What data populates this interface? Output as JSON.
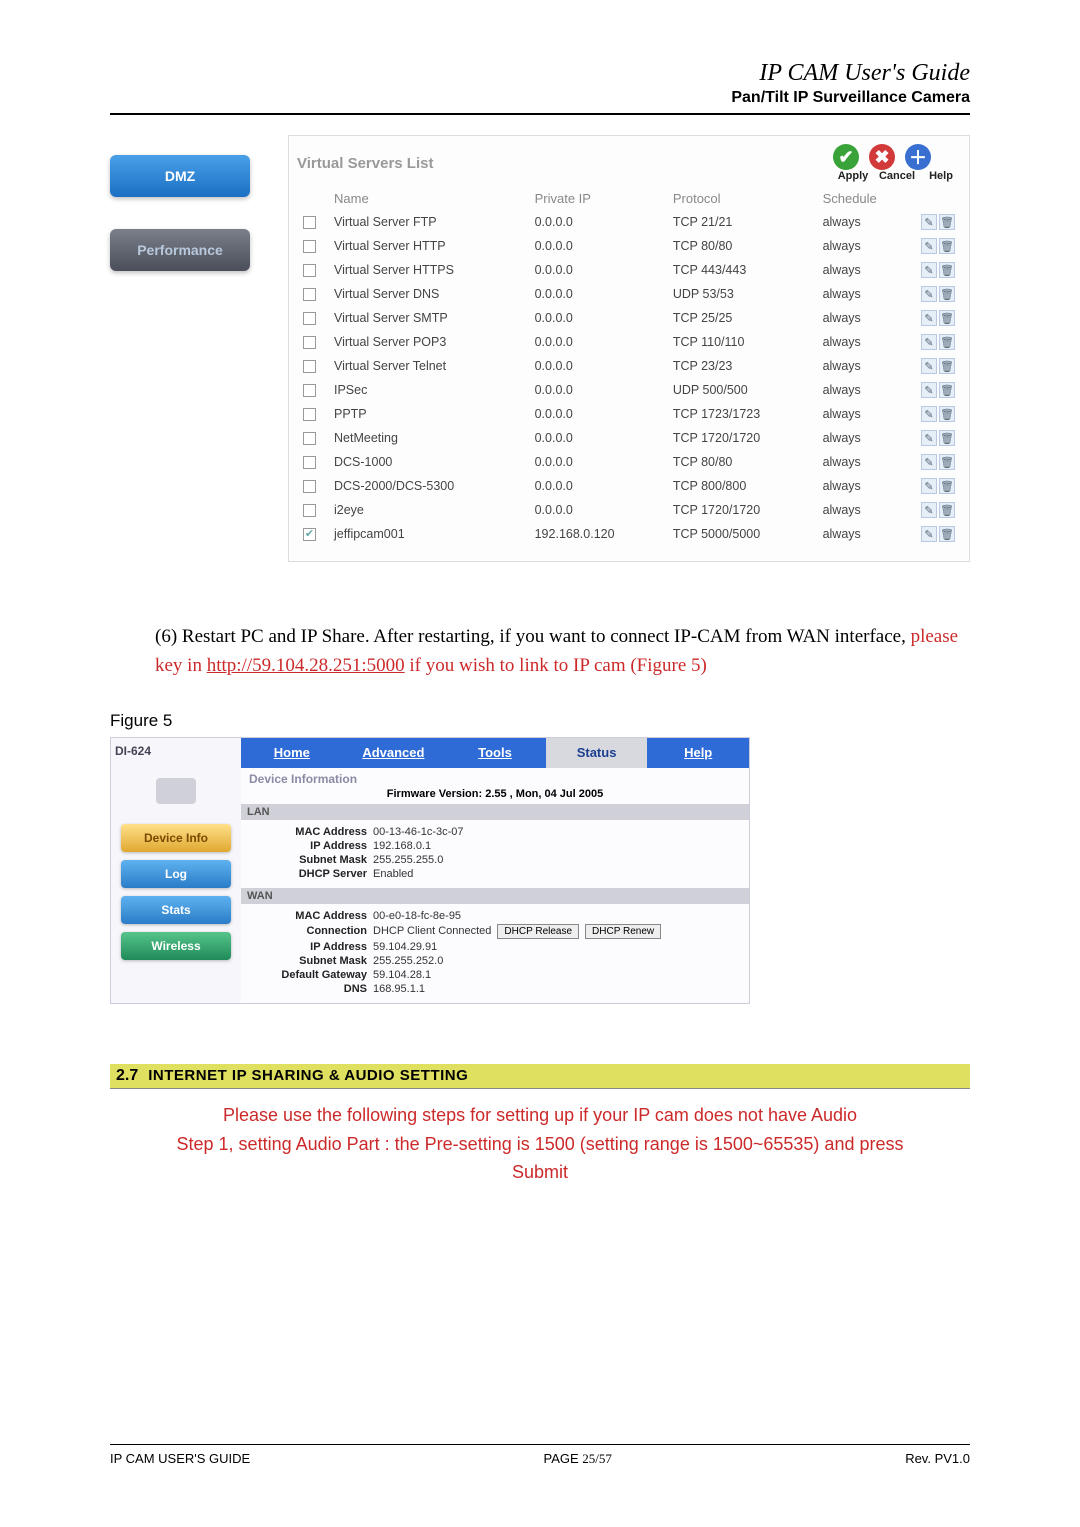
{
  "header": {
    "guide_title": "IP CAM User's Guide",
    "subtitle": "Pan/Tilt IP Surveillance Camera"
  },
  "shot1": {
    "nav": {
      "dmz": "DMZ",
      "performance": "Performance"
    },
    "title": "Virtual Servers List",
    "actions": {
      "apply": "Apply",
      "cancel": "Cancel",
      "help": "Help"
    },
    "columns": {
      "name": "Name",
      "private_ip": "Private IP",
      "protocol": "Protocol",
      "schedule": "Schedule"
    },
    "rows": [
      {
        "checked": false,
        "name": "Virtual Server FTP",
        "ip": "0.0.0.0",
        "protocol": "TCP 21/21",
        "schedule": "always"
      },
      {
        "checked": false,
        "name": "Virtual Server HTTP",
        "ip": "0.0.0.0",
        "protocol": "TCP 80/80",
        "schedule": "always"
      },
      {
        "checked": false,
        "name": "Virtual Server HTTPS",
        "ip": "0.0.0.0",
        "protocol": "TCP 443/443",
        "schedule": "always"
      },
      {
        "checked": false,
        "name": "Virtual Server DNS",
        "ip": "0.0.0.0",
        "protocol": "UDP 53/53",
        "schedule": "always"
      },
      {
        "checked": false,
        "name": "Virtual Server SMTP",
        "ip": "0.0.0.0",
        "protocol": "TCP 25/25",
        "schedule": "always"
      },
      {
        "checked": false,
        "name": "Virtual Server POP3",
        "ip": "0.0.0.0",
        "protocol": "TCP 110/110",
        "schedule": "always"
      },
      {
        "checked": false,
        "name": "Virtual Server Telnet",
        "ip": "0.0.0.0",
        "protocol": "TCP 23/23",
        "schedule": "always"
      },
      {
        "checked": false,
        "name": "IPSec",
        "ip": "0.0.0.0",
        "protocol": "UDP 500/500",
        "schedule": "always"
      },
      {
        "checked": false,
        "name": "PPTP",
        "ip": "0.0.0.0",
        "protocol": "TCP 1723/1723",
        "schedule": "always"
      },
      {
        "checked": false,
        "name": "NetMeeting",
        "ip": "0.0.0.0",
        "protocol": "TCP 1720/1720",
        "schedule": "always"
      },
      {
        "checked": false,
        "name": "DCS-1000",
        "ip": "0.0.0.0",
        "protocol": "TCP 80/80",
        "schedule": "always"
      },
      {
        "checked": false,
        "name": "DCS-2000/DCS-5300",
        "ip": "0.0.0.0",
        "protocol": "TCP 800/800",
        "schedule": "always"
      },
      {
        "checked": false,
        "name": "i2eye",
        "ip": "0.0.0.0",
        "protocol": "TCP 1720/1720",
        "schedule": "always"
      },
      {
        "checked": true,
        "name": "jeffipcam001",
        "ip": "192.168.0.120",
        "protocol": "TCP 5000/5000",
        "schedule": "always"
      }
    ]
  },
  "para6": {
    "lead": "(6) Restart PC and IP Share. After restarting, if you want to connect IP-CAM from WAN interface, ",
    "red_pre": "please key in ",
    "link": "http://59.104.28.251:5000",
    "red_post": " if you wish to link to IP cam (Figure 5)"
  },
  "figure5_label": "Figure 5",
  "shot2": {
    "model": "DI-624",
    "left_nav": {
      "device_info": "Device Info",
      "log": "Log",
      "stats": "Stats",
      "wireless": "Wireless"
    },
    "tabs": {
      "home": "Home",
      "advanced": "Advanced",
      "tools": "Tools",
      "status": "Status",
      "help": "Help"
    },
    "dev_info_hdr": "Device Information",
    "firmware": "Firmware Version: 2.55 , Mon, 04 Jul 2005",
    "lan_hdr": "LAN",
    "lan": {
      "mac_k": "MAC Address",
      "mac_v": "00-13-46-1c-3c-07",
      "ip_k": "IP Address",
      "ip_v": "192.168.0.1",
      "mask_k": "Subnet Mask",
      "mask_v": "255.255.255.0",
      "dhcp_k": "DHCP Server",
      "dhcp_v": "Enabled"
    },
    "wan_hdr": "WAN",
    "wan": {
      "mac_k": "MAC Address",
      "mac_v": "00-e0-18-fc-8e-95",
      "conn_k": "Connection",
      "conn_v": "DHCP Client Connected",
      "btn_release": "DHCP Release",
      "btn_renew": "DHCP Renew",
      "ip_k": "IP Address",
      "ip_v": "59.104.29.91",
      "mask_k": "Subnet Mask",
      "mask_v": "255.255.252.0",
      "gw_k": "Default Gateway",
      "gw_v": "59.104.28.1",
      "dns_k": "DNS",
      "dns_v": "168.95.1.1"
    }
  },
  "sec27": {
    "num": "2.7",
    "title": "INTERNET IP SHARING & AUDIO SETTING",
    "line1": "Please use the following steps for setting up if your IP cam does not have Audio",
    "line2": "Step 1, setting Audio Part : the Pre-setting is 1500 (setting range is 1500~65535) and press",
    "line3": "Submit"
  },
  "footer": {
    "left": "IP CAM USER'S GUIDE",
    "mid_pre": "PAGE ",
    "mid_pg": "25/57",
    "right": "Rev. PV1.0"
  }
}
